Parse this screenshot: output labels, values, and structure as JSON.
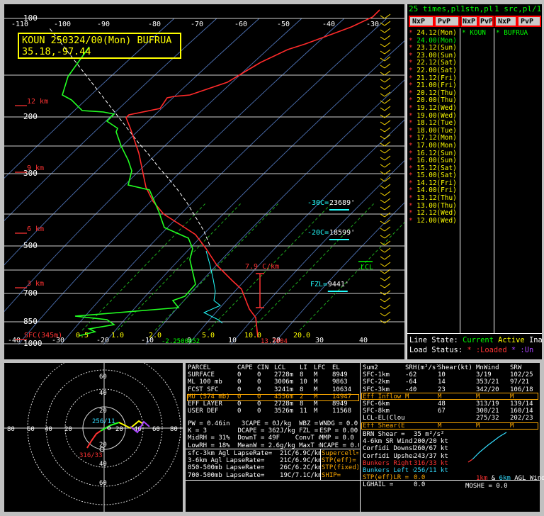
{
  "skewt": {
    "station_label": "KOUN 250324/00(Mon) BUFRUA",
    "coords_label": "35.18,-97.44",
    "temp_ticks": [
      {
        "v": -110,
        "x": 22,
        "l": "-110"
      },
      {
        "v": -100,
        "x": 82,
        "l": "-100"
      },
      {
        "v": -90,
        "x": 143,
        "l": "-90"
      },
      {
        "v": -80,
        "x": 215,
        "l": "-80"
      },
      {
        "v": -70,
        "x": 275,
        "l": "-70"
      },
      {
        "v": -60,
        "x": 337,
        "l": "-60"
      },
      {
        "v": -50,
        "x": 397,
        "l": "-50"
      },
      {
        "v": -40,
        "x": 461,
        "l": "-40"
      },
      {
        "v": -30,
        "x": 523,
        "l": "-30"
      }
    ],
    "bottom_ticks": [
      {
        "x": 13,
        "l": "-40"
      },
      {
        "x": 75,
        "l": "-30"
      },
      {
        "x": 138,
        "l": "-20"
      },
      {
        "x": 201,
        "l": "-10"
      },
      {
        "x": 266,
        "l": "0"
      },
      {
        "x": 324,
        "l": "10"
      },
      {
        "x": 386,
        "l": "20"
      },
      {
        "x": 447,
        "l": "30"
      },
      {
        "x": 509,
        "l": "40"
      }
    ],
    "pressure_levels": [
      {
        "p": 100,
        "y": 20,
        "l": "100"
      },
      {
        "p": 150,
        "y": 100,
        "l": ""
      },
      {
        "p": 200,
        "y": 159,
        "l": "200"
      },
      {
        "p": 250,
        "y": 200,
        "l": ""
      },
      {
        "p": 300,
        "y": 239,
        "l": "300"
      },
      {
        "p": 400,
        "y": 296,
        "l": ""
      },
      {
        "p": 500,
        "y": 341,
        "l": "500"
      },
      {
        "p": 600,
        "y": 375,
        "l": ""
      },
      {
        "p": 700,
        "y": 408,
        "l": "700"
      },
      {
        "p": 850,
        "y": 448,
        "l": "850"
      },
      {
        "p": 1000,
        "y": 479,
        "l": "1000"
      }
    ],
    "height_labels": [
      {
        "l": "12 km",
        "y": 140
      },
      {
        "l": "9 km",
        "y": 234
      },
      {
        "l": "6 km",
        "y": 320
      },
      {
        "l": "3 km",
        "y": 397
      },
      {
        "l": "SFC(345m)",
        "y": 470
      }
    ],
    "mixing_ratios": [
      {
        "l": "0.5",
        "x": 105
      },
      {
        "l": "1.0",
        "x": 155
      },
      {
        "l": "2.0",
        "x": 208
      },
      {
        "l": "5.0",
        "x": 283
      },
      {
        "l": "10.0",
        "x": 343
      },
      {
        "l": "20.0",
        "x": 412
      }
    ],
    "isotherm_labels": [
      {
        "l": "-30C=",
        "v": "23689'",
        "x": 428,
        "y": 283
      },
      {
        "l": "-20C=",
        "v": "18599'",
        "x": 428,
        "y": 325
      },
      {
        "l": "FZL=",
        "v": "9441'",
        "x": 432,
        "y": 398
      }
    ],
    "lapse_label": "7.9 C/km",
    "lcl_label": "LCL",
    "sfc_t_label": "-2.2500852",
    "sfc_td_label": "13.7004"
  },
  "chart_data": {
    "type": "line",
    "title": "KOUN 250324/00(Mon) BUFRUA",
    "xlabel": "",
    "ylabel": "",
    "series": [
      {
        "name": "",
        "color": "#ff2a2a",
        "points": [
          [
            530,
            8
          ],
          [
            520,
            18
          ],
          [
            490,
            32
          ],
          [
            455,
            45
          ],
          [
            425,
            56
          ],
          [
            400,
            64
          ],
          [
            362,
            82
          ],
          [
            340,
            95
          ],
          [
            315,
            110
          ],
          [
            262,
            128
          ],
          [
            240,
            130
          ],
          [
            230,
            132
          ],
          [
            220,
            147
          ],
          [
            176,
            156
          ],
          [
            172,
            160
          ],
          [
            178,
            175
          ],
          [
            190,
            210
          ],
          [
            200,
            258
          ],
          [
            210,
            278
          ],
          [
            225,
            296
          ],
          [
            250,
            312
          ],
          [
            270,
            325
          ],
          [
            285,
            345
          ],
          [
            300,
            368
          ],
          [
            322,
            390
          ],
          [
            335,
            402
          ],
          [
            342,
            420
          ],
          [
            346,
            430
          ],
          [
            355,
            442
          ],
          [
            358,
            470
          ]
        ]
      },
      {
        "name": "",
        "color": "#22ff22",
        "points": [
          [
            120,
            60
          ],
          [
            100,
            88
          ],
          [
            90,
            102
          ],
          [
            82,
            128
          ],
          [
            95,
            135
          ],
          [
            110,
            150
          ],
          [
            140,
            152
          ],
          [
            155,
            155
          ],
          [
            145,
            165
          ],
          [
            160,
            175
          ],
          [
            158,
            180
          ],
          [
            165,
            200
          ],
          [
            175,
            220
          ],
          [
            180,
            235
          ],
          [
            175,
            255
          ],
          [
            205,
            262
          ],
          [
            218,
            292
          ],
          [
            226,
            315
          ],
          [
            260,
            330
          ],
          [
            266,
            345
          ],
          [
            262,
            360
          ],
          [
            270,
            395
          ],
          [
            255,
            412
          ],
          [
            238,
            418
          ],
          [
            246,
            428
          ],
          [
            100,
            440
          ],
          [
            145,
            445
          ],
          [
            155,
            452
          ],
          [
            120,
            458
          ],
          [
            128,
            462
          ],
          [
            105,
            468
          ]
        ]
      },
      {
        "name": "",
        "color": "#22ffff",
        "points": [
          [
            285,
            348
          ],
          [
            290,
            366
          ],
          [
            295,
            388
          ],
          [
            298,
            405
          ],
          [
            296,
            418
          ],
          [
            305,
            425
          ],
          [
            282,
            435
          ],
          [
            302,
            445
          ],
          [
            308,
            450
          ]
        ]
      }
    ],
    "parcel_path": [
      [
        290,
        340
      ],
      [
        282,
        320
      ],
      [
        270,
        300
      ],
      [
        258,
        280
      ],
      [
        245,
        262
      ],
      [
        232,
        246
      ],
      [
        218,
        230
      ],
      [
        204,
        212
      ],
      [
        190,
        196
      ],
      [
        176,
        178
      ],
      [
        162,
        160
      ],
      [
        148,
        142
      ],
      [
        134,
        124
      ],
      [
        120,
        106
      ],
      [
        106,
        88
      ],
      [
        92,
        70
      ],
      [
        78,
        52
      ],
      [
        64,
        34
      ]
    ],
    "pressure_ylim": [
      1000,
      100
    ],
    "temp_xlim": [
      -110,
      -30
    ]
  },
  "side": {
    "header": "25 times,pl",
    "header2": "1stn,pl",
    "header3": "1 src,pl/1",
    "tabs": [
      "NxP",
      "PvP",
      "NxP",
      "PvP",
      "NxP",
      "PvP"
    ],
    "times": [
      {
        "t": "24.12(Mon)",
        "c": "#ffff00",
        "star": true
      },
      {
        "t": "24.00(Mon)",
        "c": "#00ff00",
        "star": true
      },
      {
        "t": "23.12(Sun)",
        "c": "#ffff00",
        "star": true
      },
      {
        "t": "23.00(Sun)",
        "c": "#ffff00",
        "star": true
      },
      {
        "t": "22.12(Sat)",
        "c": "#ffff00",
        "star": true
      },
      {
        "t": "22.00(Sat)",
        "c": "#ffff00",
        "star": true
      },
      {
        "t": "21.12(Fri)",
        "c": "#ffff00",
        "star": true
      },
      {
        "t": "21.00(Fri)",
        "c": "#ffff00",
        "star": true
      },
      {
        "t": "20.12(Thu)",
        "c": "#ffff00",
        "star": true
      },
      {
        "t": "20.00(Thu)",
        "c": "#ffff00",
        "star": true
      },
      {
        "t": "19.12(Wed)",
        "c": "#ffff00",
        "star": true
      },
      {
        "t": "19.00(Wed)",
        "c": "#ffff00",
        "star": true
      },
      {
        "t": "18.12(Tue)",
        "c": "#ffff00",
        "star": true
      },
      {
        "t": "18.00(Tue)",
        "c": "#ffff00",
        "star": true
      },
      {
        "t": "17.12(Mon)",
        "c": "#ffff00",
        "star": true
      },
      {
        "t": "17.00(Mon)",
        "c": "#ffff00",
        "star": true
      },
      {
        "t": "16.12(Sun)",
        "c": "#ffff00",
        "star": true
      },
      {
        "t": "16.00(Sun)",
        "c": "#ffff00",
        "star": true
      },
      {
        "t": "15.12(Sat)",
        "c": "#ffff00",
        "star": true
      },
      {
        "t": "15.00(Sat)",
        "c": "#ffff00",
        "star": true
      },
      {
        "t": "14.12(Fri)",
        "c": "#ffff00",
        "star": true
      },
      {
        "t": "14.00(Fri)",
        "c": "#ffff00",
        "star": true
      },
      {
        "t": "13.12(Thu)",
        "c": "#ffff00",
        "star": true
      },
      {
        "t": "13.00(Thu)",
        "c": "#ffff00",
        "star": true
      },
      {
        "t": "12.12(Wed)",
        "c": "#ffff00",
        "star": true
      },
      {
        "t": "12.00(Wed)",
        "c": "#ffff00",
        "star": true
      }
    ],
    "stn": "* KOUN",
    "src": "* BUFRUA",
    "line_state_label": "Line State:",
    "line_state_value": "Current",
    "line_state_extra": "Active",
    "line_state_tail": "Ina",
    "load_status_label": "Load Status:",
    "load_status_a": "* :Loaded",
    "load_status_b": "* :Un"
  },
  "hodo": {
    "ring_labels": [
      "60",
      "40",
      "20",
      "20",
      "40",
      "60"
    ],
    "left_labels": [
      "80",
      "60",
      "40",
      "20"
    ],
    "right_labels": [
      "20",
      "40",
      "60",
      "80"
    ],
    "bottom_labels": [
      "20",
      "40",
      "60"
    ],
    "label_mean": "256/11",
    "label_right": "316/33"
  },
  "params": {
    "head": [
      "PARCEL",
      "CAPE",
      "CIN",
      "LCL",
      "LI",
      "LFC",
      "EL"
    ],
    "parcel_rows": [
      [
        "SURFACE",
        "0",
        "0",
        "2728m",
        "8",
        "M",
        "8949"
      ],
      [
        "ML 100 mb",
        "0",
        "0",
        "3006m",
        "10",
        "M",
        "9863"
      ],
      [
        "FCST SFC",
        "0",
        "0",
        "3241m",
        "8",
        "M",
        "10634"
      ],
      [
        "MU (574 mb)",
        "0",
        "0",
        "4556m",
        "2",
        "M",
        "14947"
      ],
      [
        "EFF LAYER",
        "0",
        "0",
        "2728m",
        "8",
        "M",
        "8949"
      ],
      [
        "USER DEF",
        "0",
        "0",
        "3526m",
        "11",
        "M",
        "11568"
      ]
    ],
    "misc_rows": [
      "PW = 0.46in   3CAPE = 0J/kg  WBZ = 3863",
      "K = 3        DCAPE = 362J/kg FZL = 9441",
      "MidRH = 31%  DownT = 49F    ConvT = 52F",
      "LowRH = 18%  MeanW = 2.6g/kg MaxT = 70F"
    ],
    "misc_right": [
      "WNDG = 0.0",
      "ESP = 0.00",
      "MMP = 0.0",
      "NCAPE = 0.0"
    ],
    "lapse_rows": [
      "sfc-3km Agl LapseRate=  21C/6.9C/km",
      "3-6km Agl LapseRate=    21C/6.9C/km",
      "850-500mb LapseRate=    26C/6.2C/km",
      "700-500mb LapseRate=    19C/7.1C/km"
    ],
    "comp_rows": [
      "Supercell=",
      "STP(eff)=",
      "STP(fixed)=",
      "SHIP="
    ],
    "wind_head": [
      "Sum2",
      "SRH(m²/s²)",
      "Shear(kt)",
      "MnWind",
      "SRW"
    ],
    "wind_rows": [
      {
        "c": [
          "SFC-1km",
          "-62",
          "10",
          "3/19",
          "102/25"
        ],
        "col": "#fff"
      },
      {
        "c": [
          "SFC-2km",
          "-64",
          "14",
          "353/21",
          "97/21"
        ],
        "col": "#fff"
      },
      {
        "c": [
          "SFC-3km",
          "-40",
          "23",
          "342/20",
          "106/18"
        ],
        "col": "#fff"
      },
      {
        "c": [
          "Eff Inflow",
          "M",
          "M",
          "M",
          "M"
        ],
        "col": "#ffaa00"
      },
      {
        "c": [
          "SFC-6km",
          "",
          "48",
          "313/19",
          "139/14"
        ],
        "col": "#fff"
      },
      {
        "c": [
          "SFC-8km",
          "",
          "67",
          "300/21",
          "160/14"
        ],
        "col": "#fff"
      },
      {
        "c": [
          "LCL-EL(Cloud Layer)",
          "",
          "",
          "275/32",
          "202/23"
        ],
        "col": "#fff"
      },
      {
        "c": [
          "Eff Shear(EBWD)",
          "",
          "M",
          "M",
          "M"
        ],
        "col": "#ffaa00"
      }
    ],
    "storm_rows": [
      {
        "l": "BRN Shear =",
        "v": "35 m²/s²",
        "c": "#fff"
      },
      {
        "l": "4-6km SR Wind =",
        "v": "200/20 kt",
        "c": "#fff"
      },
      {
        "l": "Corfidi Downshear =",
        "v": "260/67 kt",
        "c": "#fff"
      },
      {
        "l": "Corfidi Upshear =",
        "v": "243/37 kt",
        "c": "#fff"
      },
      {
        "l": "Bunkers Right =",
        "v": "316/33 kt",
        "c": "#ff3333"
      },
      {
        "l": "Bunkers Left =",
        "v": "256/11 kt",
        "c": "#33ddff"
      },
      {
        "l": "STP(eff)LR =",
        "v": "0.0",
        "c": "#ffaa00"
      },
      {
        "l": "LGHAIL =",
        "v": "0.0",
        "c": "#fff"
      }
    ],
    "agl_note_a": "1km",
    "agl_note_b": "&",
    "agl_note_c": "6km",
    "agl_note_d": "AGL Wind",
    "moshe": "MOSHE = 0.0"
  },
  "colors": {
    "temp": "#ff2a2a",
    "dew": "#22ff22",
    "wetbulb": "#22ffff",
    "label": "#ffff00",
    "accent": "#00ffff"
  }
}
